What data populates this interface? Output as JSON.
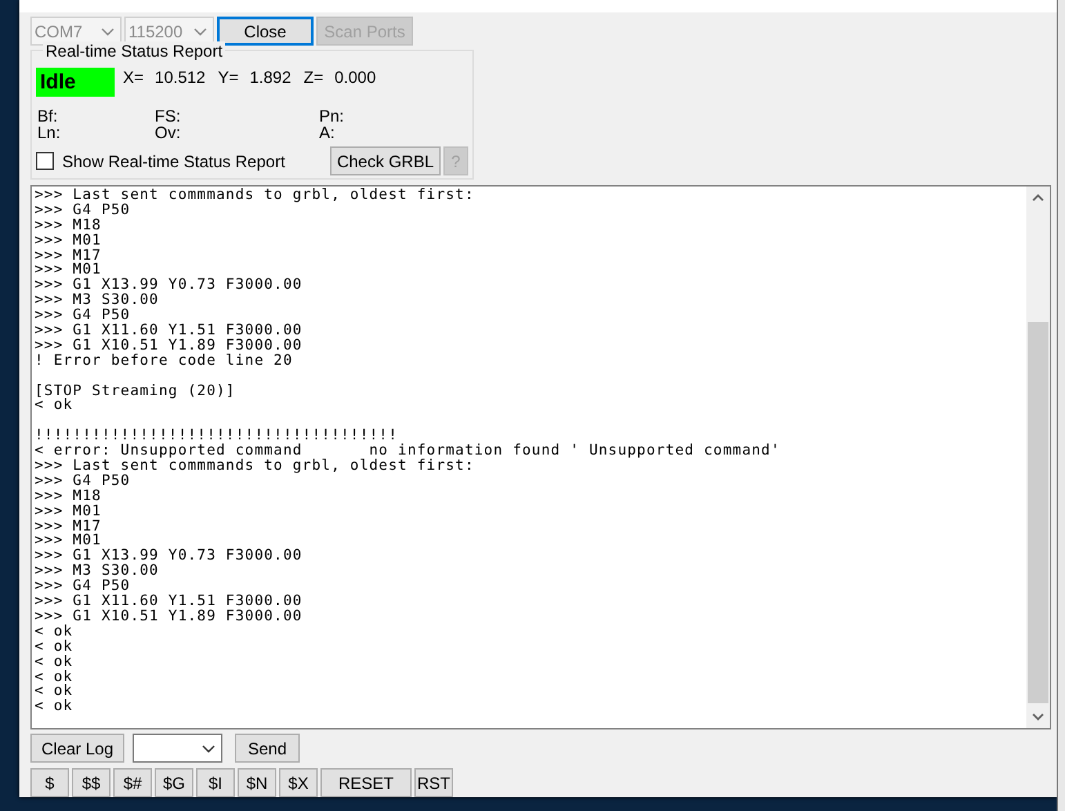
{
  "connection": {
    "port": {
      "value": "COM7",
      "disabled": true
    },
    "baud": {
      "value": "115200",
      "disabled": true
    },
    "buttons": [
      {
        "label": "Close",
        "disabled": false,
        "focused": true
      },
      {
        "label": "Scan Ports",
        "disabled": true,
        "focused": false
      }
    ]
  },
  "status_report": {
    "title": "Real-time Status Report",
    "state": {
      "label": "Idle",
      "color": "#00ff00"
    },
    "position": [
      {
        "label": "X=",
        "value": "10.512"
      },
      {
        "label": "Y=",
        "value": "1.892"
      },
      {
        "label": "Z=",
        "value": "0.000"
      }
    ],
    "fields": [
      [
        "Bf:",
        "FS:",
        "Pn:"
      ],
      [
        "Ln:",
        "Ov:",
        "A:"
      ]
    ],
    "show_checkbox": {
      "label": "Show Real-time Status Report",
      "checked": false
    },
    "buttons": [
      {
        "label": "Check GRBL",
        "disabled": false
      },
      {
        "label": "?",
        "disabled": true
      }
    ]
  },
  "log": {
    "lines": [
      {
        "kind": "text",
        "text": ">>> Last sent commmands to grbl, oldest first:"
      },
      {
        "kind": "text",
        "text": ">>> G4 P50"
      },
      {
        "kind": "text",
        "text": ">>> M18"
      },
      {
        "kind": "text",
        "text": ">>> M01"
      },
      {
        "kind": "text",
        "text": ">>> M17"
      },
      {
        "kind": "text",
        "text": ">>> M01"
      },
      {
        "kind": "text",
        "text": ">>> G1 X13.99 Y0.73 F3000.00"
      },
      {
        "kind": "text",
        "text": ">>> M3 S30.00"
      },
      {
        "kind": "text",
        "text": ">>> G4 P50"
      },
      {
        "kind": "text",
        "text": ">>> G1 X11.60 Y1.51 F3000.00"
      },
      {
        "kind": "text",
        "text": ">>> G1 X10.51 Y1.89 F3000.00"
      },
      {
        "kind": "text",
        "text": "! Error before code line 20"
      },
      {
        "kind": "blank"
      },
      {
        "kind": "text",
        "text": "[STOP Streaming (20)]"
      },
      {
        "kind": "text",
        "text": "< ok"
      },
      {
        "kind": "blank"
      },
      {
        "kind": "text",
        "text": "!!!!!!!!!!!!!!!!!!!!!!!!!!!!!!!!!!!!!!"
      },
      {
        "kind": "text",
        "text": "< error: Unsupported command       no information found ' Unsupported command'"
      },
      {
        "kind": "text",
        "text": ">>> Last sent commmands to grbl, oldest first:"
      },
      {
        "kind": "text",
        "text": ">>> G4 P50"
      },
      {
        "kind": "text",
        "text": ">>> M18"
      },
      {
        "kind": "text",
        "text": ">>> M01"
      },
      {
        "kind": "text",
        "text": ">>> M17"
      },
      {
        "kind": "text",
        "text": ">>> M01"
      },
      {
        "kind": "text",
        "text": ">>> G1 X13.99 Y0.73 F3000.00"
      },
      {
        "kind": "text",
        "text": ">>> M3 S30.00"
      },
      {
        "kind": "text",
        "text": ">>> G4 P50"
      },
      {
        "kind": "text",
        "text": ">>> G1 X11.60 Y1.51 F3000.00"
      },
      {
        "kind": "text",
        "text": ">>> G1 X10.51 Y1.89 F3000.00"
      },
      {
        "kind": "text",
        "text": "< ok"
      },
      {
        "kind": "text",
        "text": "< ok"
      },
      {
        "kind": "text",
        "text": "< ok"
      },
      {
        "kind": "text",
        "text": "< ok"
      },
      {
        "kind": "text",
        "text": "< ok"
      },
      {
        "kind": "text",
        "text": "< ok"
      }
    ]
  },
  "command_row": {
    "clear_button": "Clear Log",
    "send_button": "Send"
  },
  "quick_buttons": [
    "$",
    "$$",
    "$#",
    "$G",
    "$I",
    "$N",
    "$X",
    "RESET",
    "RST"
  ]
}
